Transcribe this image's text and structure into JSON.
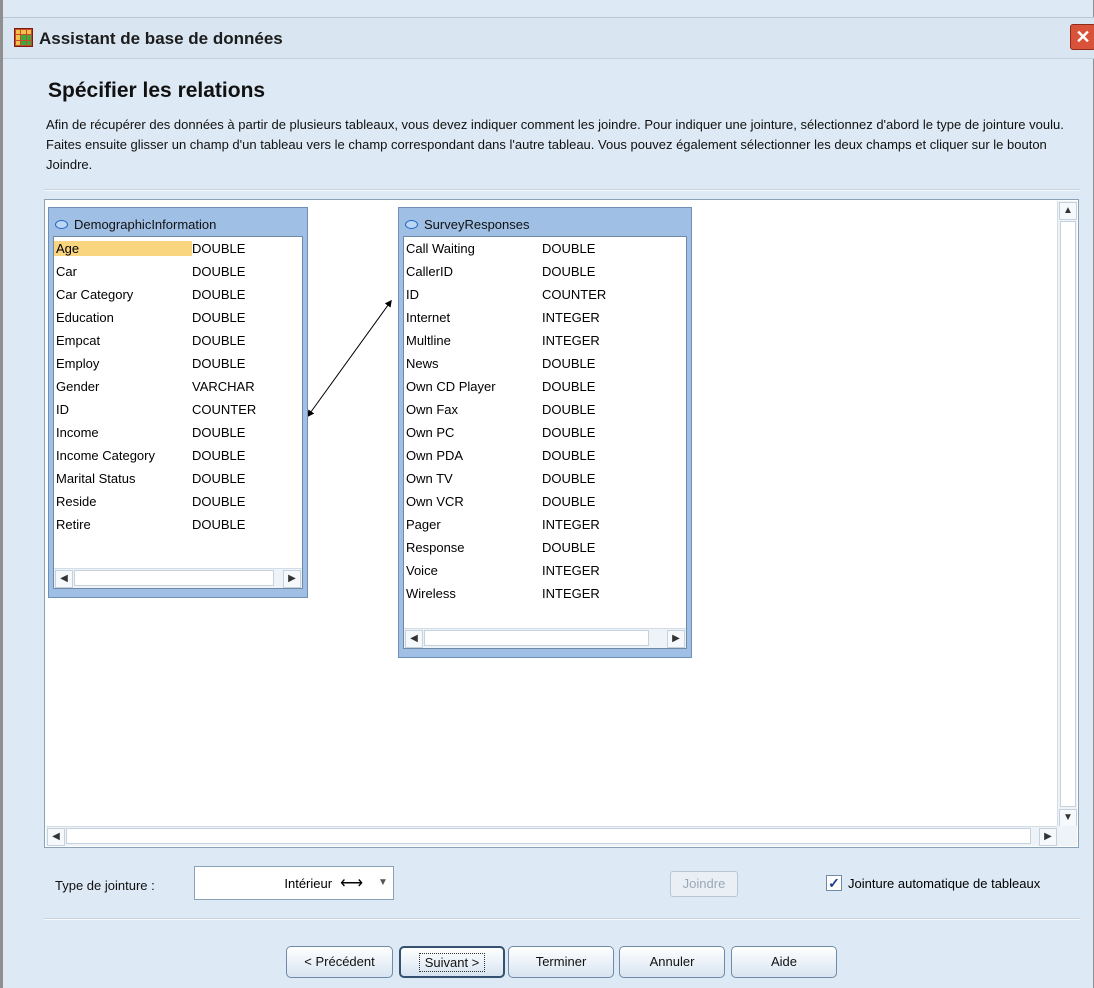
{
  "window": {
    "title": "Assistant de base de données",
    "close_glyph": "✕"
  },
  "page": {
    "title": "Spécifier les relations",
    "intro": "Afin de récupérer des données à partir de plusieurs tableaux, vous devez indiquer comment les joindre. Pour indiquer une jointure, sélectionnez d'abord le type de jointure voulu. Faites ensuite glisser un champ d'un tableau vers le champ correspondant dans l'autre tableau. Vous pouvez également sélectionner les deux champs et cliquer sur le bouton Joindre."
  },
  "tables": [
    {
      "name": "DemographicInformation",
      "fields": [
        {
          "name": "Age",
          "type": "DOUBLE"
        },
        {
          "name": "Car",
          "type": "DOUBLE"
        },
        {
          "name": "Car Category",
          "type": "DOUBLE"
        },
        {
          "name": "Education",
          "type": "DOUBLE"
        },
        {
          "name": "Empcat",
          "type": "DOUBLE"
        },
        {
          "name": "Employ",
          "type": "DOUBLE"
        },
        {
          "name": "Gender",
          "type": "VARCHAR"
        },
        {
          "name": "ID",
          "type": "COUNTER"
        },
        {
          "name": "Income",
          "type": "DOUBLE"
        },
        {
          "name": "Income Category",
          "type": "DOUBLE"
        },
        {
          "name": "Marital Status",
          "type": "DOUBLE"
        },
        {
          "name": "Reside",
          "type": "DOUBLE"
        },
        {
          "name": "Retire",
          "type": "DOUBLE"
        }
      ]
    },
    {
      "name": "SurveyResponses",
      "fields": [
        {
          "name": "Call Waiting",
          "type": "DOUBLE"
        },
        {
          "name": "CallerID",
          "type": "DOUBLE"
        },
        {
          "name": "ID",
          "type": "COUNTER"
        },
        {
          "name": "Internet",
          "type": "INTEGER"
        },
        {
          "name": "Multline",
          "type": "INTEGER"
        },
        {
          "name": "News",
          "type": "DOUBLE"
        },
        {
          "name": "Own CD Player",
          "type": "DOUBLE"
        },
        {
          "name": "Own Fax",
          "type": "DOUBLE"
        },
        {
          "name": "Own PC",
          "type": "DOUBLE"
        },
        {
          "name": "Own PDA",
          "type": "DOUBLE"
        },
        {
          "name": "Own TV",
          "type": "DOUBLE"
        },
        {
          "name": "Own VCR",
          "type": "DOUBLE"
        },
        {
          "name": "Pager",
          "type": "INTEGER"
        },
        {
          "name": "Response",
          "type": "DOUBLE"
        },
        {
          "name": "Voice",
          "type": "INTEGER"
        },
        {
          "name": "Wireless",
          "type": "INTEGER"
        }
      ]
    }
  ],
  "join": {
    "label": "Type de jointure :",
    "value": "Intérieur",
    "value_icon": "⟷",
    "joindre_label": "Joindre",
    "auto_join_label": "Jointure automatique de tableaux",
    "auto_join_checked": true,
    "check_glyph": "✓"
  },
  "buttons": {
    "previous": "< Précédent",
    "next": "Suivant >",
    "finish": "Terminer",
    "cancel": "Annuler",
    "help": "Aide"
  },
  "icons": {
    "up": "▲",
    "down": "▼",
    "left": "◀",
    "right": "▶"
  }
}
